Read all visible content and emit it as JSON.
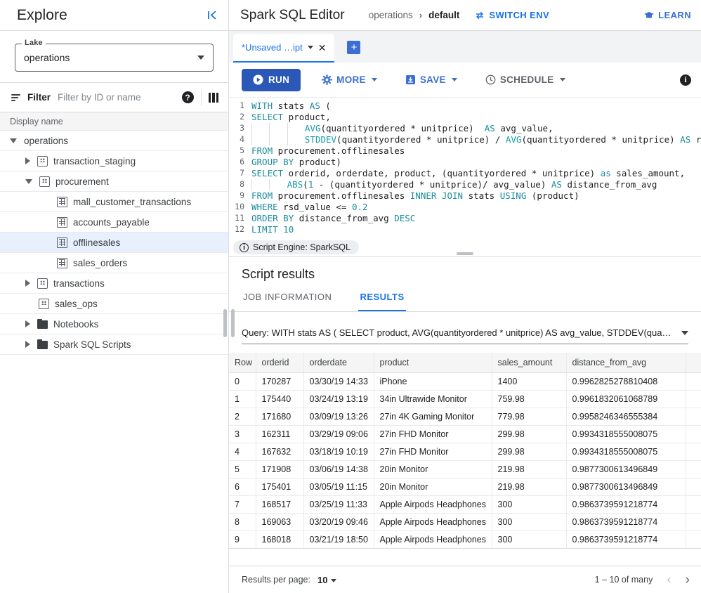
{
  "sidebar": {
    "title": "Explore",
    "collapse_icon": "collapse-left-icon",
    "lake": {
      "label": "Lake",
      "value": "operations"
    },
    "filter": {
      "label": "Filter",
      "placeholder": "Filter by ID or name",
      "help_icon": "help-icon",
      "columns_icon": "columns-icon"
    },
    "column_header": "Display name",
    "tree": [
      {
        "label": "operations",
        "icon": "none",
        "caret": "down",
        "indent": 14,
        "selected": false
      },
      {
        "label": "transaction_staging",
        "icon": "db",
        "caret": "right",
        "indent": 36,
        "selected": false
      },
      {
        "label": "procurement",
        "icon": "db",
        "caret": "down",
        "indent": 36,
        "selected": false
      },
      {
        "label": "mall_customer_transactions",
        "icon": "table",
        "caret": "none",
        "indent": 62,
        "selected": false
      },
      {
        "label": "accounts_payable",
        "icon": "table",
        "caret": "none",
        "indent": 62,
        "selected": false
      },
      {
        "label": "offlinesales",
        "icon": "table",
        "caret": "none",
        "indent": 62,
        "selected": true
      },
      {
        "label": "sales_orders",
        "icon": "table",
        "caret": "none",
        "indent": 62,
        "selected": false
      },
      {
        "label": "transactions",
        "icon": "db",
        "caret": "right",
        "indent": 36,
        "selected": false
      },
      {
        "label": "sales_ops",
        "icon": "db",
        "caret": "none",
        "indent": 36,
        "selected": false
      },
      {
        "label": "Notebooks",
        "icon": "folder",
        "caret": "right",
        "indent": 36,
        "selected": false
      },
      {
        "label": "Spark SQL Scripts",
        "icon": "folder",
        "caret": "right",
        "indent": 36,
        "selected": false
      }
    ]
  },
  "header": {
    "app_title": "Spark SQL Editor",
    "breadcrumb_root": "operations",
    "breadcrumb_sep": "›",
    "breadcrumb_current": "default",
    "switch_env": "SWITCH ENV",
    "switch_env_icon": "swap-icon",
    "learn": "LEARN",
    "learn_icon": "graduation-cap-icon"
  },
  "tabs": {
    "active": {
      "label": "*Unsaved …ipt",
      "caret_icon": "chevron-down-icon",
      "close_icon": "close-icon"
    },
    "add_icon": "plus-icon"
  },
  "toolbar": {
    "run": "RUN",
    "run_icon": "play-icon",
    "more": "MORE",
    "more_icon": "gear-icon",
    "save": "SAVE",
    "save_icon": "save-disk-icon",
    "schedule": "SCHEDULE",
    "schedule_icon": "clock-icon",
    "info_icon": "info-icon"
  },
  "editor": {
    "lines": [
      {
        "n": "1",
        "indent": 0,
        "tokens": [
          {
            "t": "WITH ",
            "c": "kw"
          },
          {
            "t": "stats ",
            "c": ""
          },
          {
            "t": "AS",
            "c": "kw"
          },
          {
            "t": " (",
            "c": ""
          }
        ]
      },
      {
        "n": "2",
        "indent": 0,
        "tokens": [
          {
            "t": "SELECT",
            "c": "kw"
          },
          {
            "t": " product,",
            "c": ""
          }
        ]
      },
      {
        "n": "3",
        "indent": 3,
        "tokens": [
          {
            "t": "AVG",
            "c": "fn"
          },
          {
            "t": "(quantityordered * unitprice)  ",
            "c": ""
          },
          {
            "t": "AS",
            "c": "kw"
          },
          {
            "t": " avg_value,",
            "c": ""
          }
        ]
      },
      {
        "n": "4",
        "indent": 3,
        "tokens": [
          {
            "t": "STDDEV",
            "c": "fn"
          },
          {
            "t": "(quantityordered * unitprice) / ",
            "c": ""
          },
          {
            "t": "AVG",
            "c": "fn"
          },
          {
            "t": "(quantityordered * unitprice) ",
            "c": ""
          },
          {
            "t": "AS",
            "c": "kw"
          },
          {
            "t": " rsd_v",
            "c": ""
          }
        ]
      },
      {
        "n": "5",
        "indent": 0,
        "tokens": [
          {
            "t": "FROM",
            "c": "kw"
          },
          {
            "t": " procurement.offlinesales",
            "c": ""
          }
        ]
      },
      {
        "n": "6",
        "indent": 0,
        "tokens": [
          {
            "t": "GROUP BY",
            "c": "kw"
          },
          {
            "t": " product)",
            "c": ""
          }
        ]
      },
      {
        "n": "7",
        "indent": 0,
        "tokens": [
          {
            "t": "SELECT",
            "c": "kw"
          },
          {
            "t": " orderid, orderdate, product, (quantityordered * unitprice) ",
            "c": ""
          },
          {
            "t": "as",
            "c": "kw"
          },
          {
            "t": " sales_amount,",
            "c": ""
          }
        ]
      },
      {
        "n": "8",
        "indent": 2,
        "tokens": [
          {
            "t": "ABS",
            "c": "fn"
          },
          {
            "t": "(",
            "c": ""
          },
          {
            "t": "1",
            "c": "num"
          },
          {
            "t": " - (quantityordered * unitprice)/ avg_value) ",
            "c": ""
          },
          {
            "t": "AS",
            "c": "kw"
          },
          {
            "t": " distance_from_avg",
            "c": ""
          }
        ]
      },
      {
        "n": "9",
        "indent": 0,
        "tokens": [
          {
            "t": "FROM",
            "c": "kw"
          },
          {
            "t": " procurement.offlinesales ",
            "c": ""
          },
          {
            "t": "INNER JOIN",
            "c": "kw"
          },
          {
            "t": " stats ",
            "c": ""
          },
          {
            "t": "USING",
            "c": "kw"
          },
          {
            "t": " (product)",
            "c": ""
          }
        ]
      },
      {
        "n": "10",
        "indent": 0,
        "tokens": [
          {
            "t": "WHERE",
            "c": "kw"
          },
          {
            "t": " rsd_value <= ",
            "c": ""
          },
          {
            "t": "0.2",
            "c": "num"
          }
        ]
      },
      {
        "n": "11",
        "indent": 0,
        "tokens": [
          {
            "t": "ORDER BY",
            "c": "kw"
          },
          {
            "t": " distance_from_avg ",
            "c": ""
          },
          {
            "t": "DESC",
            "c": "kw"
          }
        ]
      },
      {
        "n": "12",
        "indent": 0,
        "tokens": [
          {
            "t": "LIMIT",
            "c": "kw"
          },
          {
            "t": " ",
            "c": ""
          },
          {
            "t": "10",
            "c": "num"
          }
        ]
      }
    ],
    "engine_chip": "Script Engine: SparkSQL",
    "engine_icon": "info-icon",
    "resize_handle": "panel-resize-handle"
  },
  "results": {
    "title": "Script results",
    "tabs": [
      {
        "label": "JOB INFORMATION",
        "active": false
      },
      {
        "label": "RESULTS",
        "active": true
      }
    ],
    "query_select": "Query: WITH stats AS ( SELECT product, AVG(quantityordered * unitprice) AS avg_value, STDDEV(quantityorder…",
    "columns": [
      "Row",
      "orderid",
      "orderdate",
      "product",
      "sales_amount",
      "distance_from_avg",
      ""
    ],
    "rows": [
      [
        "0",
        "170287",
        "03/30/19 14:33",
        "iPhone",
        "1400",
        "0.9962825278810408",
        ""
      ],
      [
        "1",
        "175440",
        "03/24/19 13:19",
        "34in Ultrawide Monitor",
        "759.98",
        "0.9961832061068789",
        ""
      ],
      [
        "2",
        "171680",
        "03/09/19 13:26",
        "27in 4K Gaming Monitor",
        "779.98",
        "0.9958246346555384",
        ""
      ],
      [
        "3",
        "162311",
        "03/29/19 09:06",
        "27in FHD Monitor",
        "299.98",
        "0.9934318555008075",
        ""
      ],
      [
        "4",
        "167632",
        "03/18/19 10:19",
        "27in FHD Monitor",
        "299.98",
        "0.9934318555008075",
        ""
      ],
      [
        "5",
        "171908",
        "03/06/19 14:38",
        "20in Monitor",
        "219.98",
        "0.9877300613496849",
        ""
      ],
      [
        "6",
        "175401",
        "03/05/19 11:15",
        "20in Monitor",
        "219.98",
        "0.9877300613496849",
        ""
      ],
      [
        "7",
        "168517",
        "03/25/19 11:33",
        "Apple Airpods Headphones",
        "300",
        "0.9863739591218774",
        ""
      ],
      [
        "8",
        "169063",
        "03/20/19 09:46",
        "Apple Airpods Headphones",
        "300",
        "0.9863739591218774",
        ""
      ],
      [
        "9",
        "168018",
        "03/21/19 18:50",
        "Apple Airpods Headphones",
        "300",
        "0.9863739591218774",
        ""
      ]
    ]
  },
  "footer": {
    "per_page_label": "Results per page:",
    "per_page_value": "10",
    "range": "1 – 10 of many",
    "prev_icon": "chevron-left-icon",
    "next_icon": "chevron-right-icon"
  },
  "colors": {
    "accent": "#1a73e8",
    "run_button": "#2b58b7",
    "selected_row": "#e8f0fe",
    "sql_keyword": "#1a8b9d"
  }
}
